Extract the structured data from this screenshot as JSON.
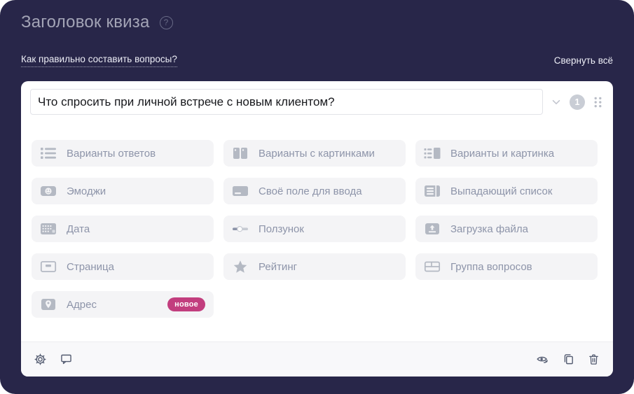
{
  "header": {
    "title": "Заголовок квиза",
    "help_icon": "question-circle-icon",
    "guide_link": "Как правильно составить вопросы?",
    "collapse_all": "Свернуть всё"
  },
  "question_card": {
    "title_value": "Что спросить при личной встрече с новым клиентом?",
    "number_badge": "1",
    "control_icons": [
      "chevron-down-icon",
      "question-number-badge",
      "drag-handle-icon"
    ]
  },
  "question_types": [
    {
      "label": "Варианты ответов",
      "icon": "choice-list-icon"
    },
    {
      "label": "Варианты с картинками",
      "icon": "image-options-icon"
    },
    {
      "label": "Варианты и картинка",
      "icon": "list-and-image-icon"
    },
    {
      "label": "Эмоджи",
      "icon": "emoji-icon"
    },
    {
      "label": "Своё поле для ввода",
      "icon": "input-field-icon"
    },
    {
      "label": "Выпадающий список",
      "icon": "dropdown-list-icon"
    },
    {
      "label": "Дата",
      "icon": "calendar-date-icon"
    },
    {
      "label": "Ползунок",
      "icon": "slider-icon"
    },
    {
      "label": "Загрузка файла",
      "icon": "file-upload-icon"
    },
    {
      "label": "Страница",
      "icon": "page-icon"
    },
    {
      "label": "Рейтинг",
      "icon": "star-rating-icon"
    },
    {
      "label": "Группа вопросов",
      "icon": "question-group-icon"
    },
    {
      "label": "Адрес",
      "icon": "address-pin-icon",
      "badge": "новое"
    }
  ],
  "footer": {
    "left_icons": [
      "settings-gear-icon",
      "comment-icon"
    ],
    "right_icons": [
      "preview-eye-icon",
      "duplicate-copy-icon",
      "delete-trash-icon"
    ]
  },
  "colors": {
    "panel_background": "#282649",
    "card_background": "#ffffff",
    "button_background": "#f4f4f6",
    "button_text": "#8d94a9",
    "icon_gray": "#b4b9c3",
    "new_badge": "#c23e7e",
    "footer_background": "#f8f8fa"
  }
}
